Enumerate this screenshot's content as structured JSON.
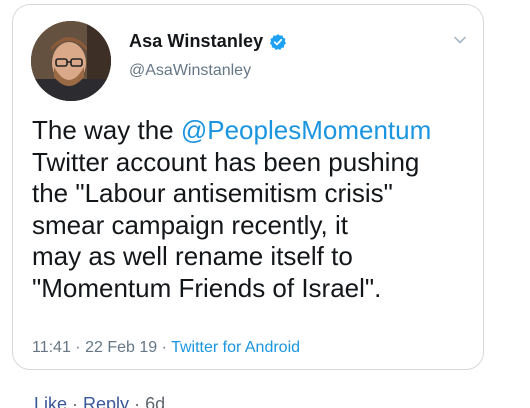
{
  "tweet": {
    "author": {
      "display_name": "Asa Winstanley",
      "handle": "@AsaWinstanley",
      "verified_icon": "verified-badge-icon",
      "avatar_icon": "profile-photo"
    },
    "menu_icon": "chevron-down-icon",
    "text": {
      "line1_prefix": "The way the ",
      "line1_mention": "@PeoplesMomentum",
      "line2": "Twitter account has been pushing",
      "line3": "the \"Labour antisemitism crisis\"",
      "line4": "smear campaign recently, it",
      "line5": "may as well rename itself to",
      "line6": "\"Momentum Friends of Israel\"."
    },
    "meta": {
      "time": "11:41",
      "sep1": " · ",
      "date": "22 Feb 19",
      "sep2": " · ",
      "source": "Twitter for Android"
    },
    "colors": {
      "link": "#1b95e0",
      "text": "#14171a",
      "muted": "#657786"
    }
  },
  "comment_actions": {
    "like": "Like",
    "sep1": " · ",
    "reply": "Reply",
    "sep2": " · ",
    "age": "6d"
  }
}
